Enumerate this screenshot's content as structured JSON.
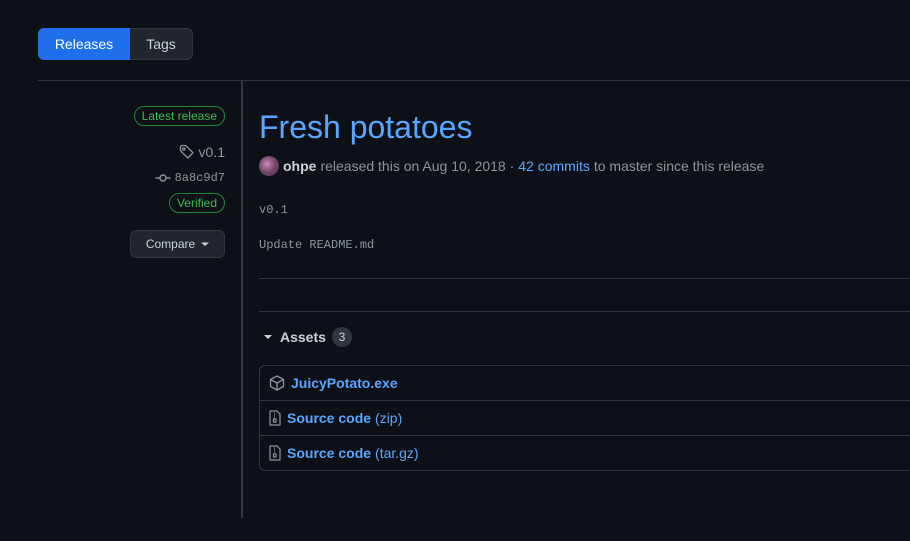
{
  "tabs": [
    {
      "label": "Releases",
      "active": true
    },
    {
      "label": "Tags",
      "active": false
    }
  ],
  "sidebar": {
    "latest_badge": "Latest release",
    "tag": "v0.1",
    "commit": "8a8c9d7",
    "verified_badge": "Verified",
    "compare_label": "Compare"
  },
  "release": {
    "title": "Fresh potatoes",
    "author": "ohpe",
    "released_text": "released this on Aug 10, 2018 ·",
    "commits_link": "42 commits",
    "since_text": "to master since this release",
    "body": [
      "v0.1",
      "Update README.md"
    ]
  },
  "assets": {
    "heading": "Assets",
    "count": "3",
    "items": [
      {
        "name": "JuicyPotato.exe",
        "ext": "",
        "icon": "package-icon"
      },
      {
        "name": "Source code",
        "ext": "(zip)",
        "icon": "file-zip-icon"
      },
      {
        "name": "Source code",
        "ext": "(tar.gz)",
        "icon": "file-zip-icon"
      }
    ]
  },
  "colors": {
    "background": "#0d1117",
    "accent": "#58a6ff",
    "active_tab": "#1f6feb",
    "success": "#3fb950",
    "border": "#30363d"
  }
}
